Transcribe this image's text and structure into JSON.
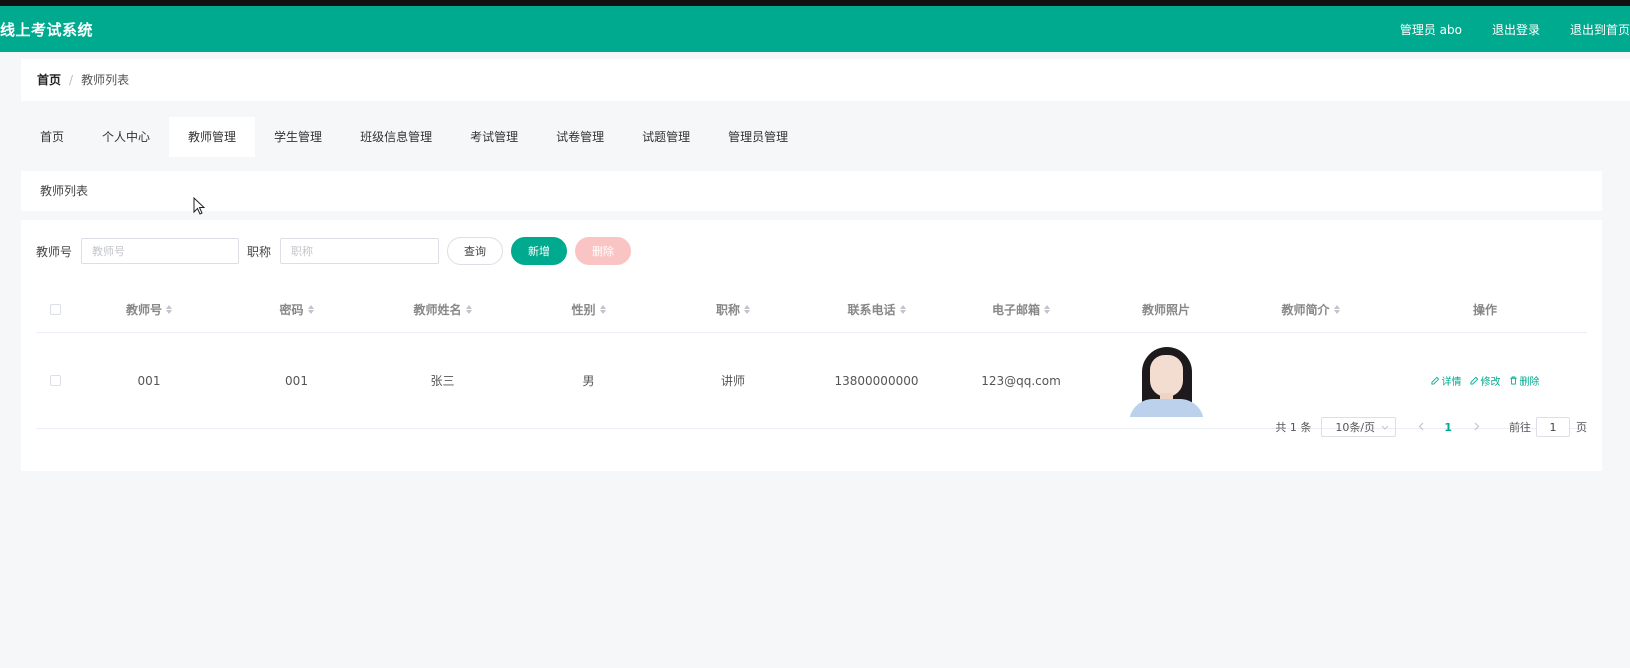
{
  "header": {
    "brand": "线上考试系统",
    "user": "管理员 abo",
    "logout": "退出登录",
    "back_home": "退出到首页"
  },
  "colors": {
    "accent": "#00aa8e",
    "danger_disabled": "#fbc4c4",
    "page_bg": "#f6f7f9"
  },
  "breadcrumb": {
    "home": "首页",
    "separator": "/",
    "current": "教师列表"
  },
  "tabs": [
    {
      "label": "首页"
    },
    {
      "label": "个人中心"
    },
    {
      "label": "教师管理",
      "active": true
    },
    {
      "label": "学生管理"
    },
    {
      "label": "班级信息管理"
    },
    {
      "label": "考试管理"
    },
    {
      "label": "试卷管理"
    },
    {
      "label": "试题管理"
    },
    {
      "label": "管理员管理"
    }
  ],
  "section_title": "教师列表",
  "search": {
    "teacher_no_label": "教师号",
    "teacher_no_placeholder": "教师号",
    "title_label": "职称",
    "title_placeholder": "职称",
    "query_label": "查询",
    "add_label": "新增",
    "delete_label": "删除"
  },
  "table": {
    "columns": [
      "教师号",
      "密码",
      "教师姓名",
      "性别",
      "职称",
      "联系电话",
      "电子邮箱",
      "教师照片",
      "教师简介",
      "操作"
    ],
    "rows": [
      {
        "teacher_no": "001",
        "password": "001",
        "name": "张三",
        "gender": "男",
        "title": "讲师",
        "phone": "13800000000",
        "email": "123@qq.com",
        "intro": "",
        "actions": {
          "detail": "详情",
          "edit": "修改",
          "delete": "删除"
        }
      }
    ]
  },
  "pagination": {
    "total_text": "共 1 条",
    "page_size": "10条/页",
    "prev_icon": "chevron-left-icon",
    "next_icon": "chevron-right-icon",
    "current_page": "1",
    "goto_label": "前往",
    "goto_value": "1",
    "page_suffix": "页"
  }
}
